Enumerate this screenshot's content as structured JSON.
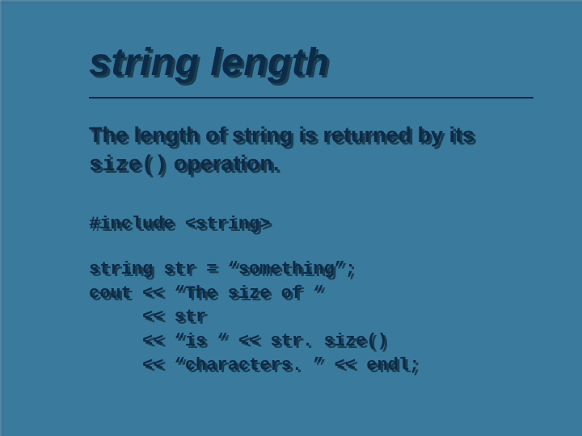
{
  "title": "string length",
  "body": {
    "part1": "The length of string is returned by its ",
    "code_inline": "size()",
    "part2": " operation",
    "period": "."
  },
  "code": {
    "include": "#include <string>",
    "l1": "string str = “something”;",
    "l2": "cout << “The size of “",
    "l3": "     << str",
    "l4": "     << “is “ << str. size()",
    "l5": "     << “characters. ” << endl;"
  }
}
